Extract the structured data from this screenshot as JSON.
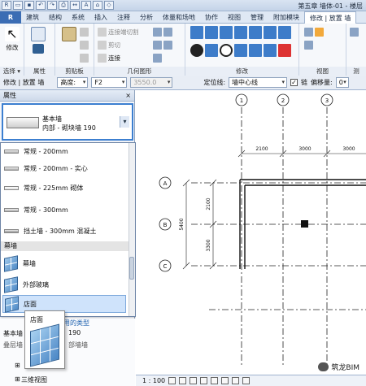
{
  "window": {
    "title": "第五章 墙体-01 - 楼层"
  },
  "ribbon_tabs": [
    "建筑",
    "结构",
    "系统",
    "插入",
    "注释",
    "分析",
    "体量和场地",
    "协作",
    "视图",
    "管理",
    "附加模块",
    "修改 | 放置 墙"
  ],
  "ribbon": {
    "modify_label": "修改",
    "group_select": "选择 ▾",
    "group_properties": "属性",
    "group_clipboard": "剪贴板",
    "group_geometry": "几何图形",
    "group_modify": "修改",
    "group_view": "视图",
    "group_measure": "测",
    "geom_items": [
      "连接端切割",
      "剪切",
      "连接"
    ],
    "clip_items": [
      "粘贴"
    ]
  },
  "options_bar": {
    "context": "修改 | 放置 墙",
    "height_label": "高度:",
    "height_value": "F2",
    "height_num": "3550.0",
    "location_label": "定位线:",
    "location_value": "墙中心线",
    "chain_label": "链",
    "offset_label": "偏移量:",
    "offset_value": "0"
  },
  "properties": {
    "header": "属性",
    "close": "×",
    "type_family": "基本墙",
    "type_name": "内部 - 砌块墙 190"
  },
  "type_list": {
    "items": [
      {
        "label": "常规 - 200mm",
        "kind": "wall"
      },
      {
        "label": "常规 - 200mm - 实心",
        "kind": "wall"
      },
      {
        "label": "常规 - 225mm 砌体",
        "kind": "wall"
      },
      {
        "label": "常规 - 300mm",
        "kind": "wall"
      },
      {
        "label": "挡土墙 - 300mm 混凝土",
        "kind": "wall"
      }
    ],
    "group_header": "幕墙",
    "curtain_items": [
      {
        "label": "幕墙",
        "kind": "curtain"
      },
      {
        "label": "外部玻璃",
        "kind": "curtain"
      },
      {
        "label": "店面",
        "kind": "curtain",
        "selected": true
      }
    ],
    "recent_label": "最近使用的类型"
  },
  "below_list": {
    "row1_a": "基本墙",
    "row1_b": "190",
    "row2_a": "叠层墙",
    "row2_b": "部墙墙",
    "row3": "三维视图"
  },
  "tooltip": {
    "title": "店面"
  },
  "drawing": {
    "grid_labels_top": [
      "1",
      "2",
      "3"
    ],
    "grid_labels_left": [
      "A",
      "B",
      "C"
    ],
    "dims_top": [
      "2100",
      "3000",
      "3000"
    ],
    "dims_left_a": "2100",
    "dims_left_b": "3300",
    "dims_left_total": "5400"
  },
  "status": {
    "scale": "1 : 100"
  },
  "watermark": {
    "text": "筑龙BIM"
  }
}
